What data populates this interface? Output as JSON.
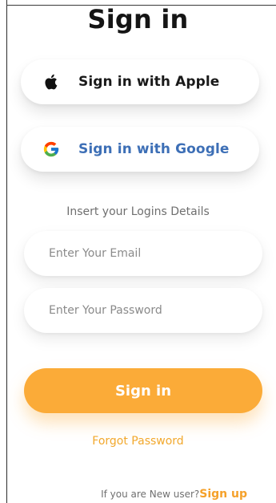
{
  "title": "Sign in",
  "social": {
    "apple": {
      "label": "Sign in with Apple",
      "icon": "apple-icon"
    },
    "google": {
      "label": "Sign in with Google",
      "icon": "google-icon"
    }
  },
  "form": {
    "hint": "Insert your Logins Details",
    "email_placeholder": "Enter Your Email",
    "email_value": "",
    "password_placeholder": "Enter Your Password",
    "password_value": "",
    "submit_label": "Sign in",
    "forgot_label": "Forgot Password"
  },
  "footer": {
    "prompt": "If you are New user?",
    "signup_label": "Sign up"
  },
  "colors": {
    "accent": "#fbab38",
    "link": "#f2a82c",
    "google_text": "#3d6fb6",
    "background": "#ffffff"
  }
}
